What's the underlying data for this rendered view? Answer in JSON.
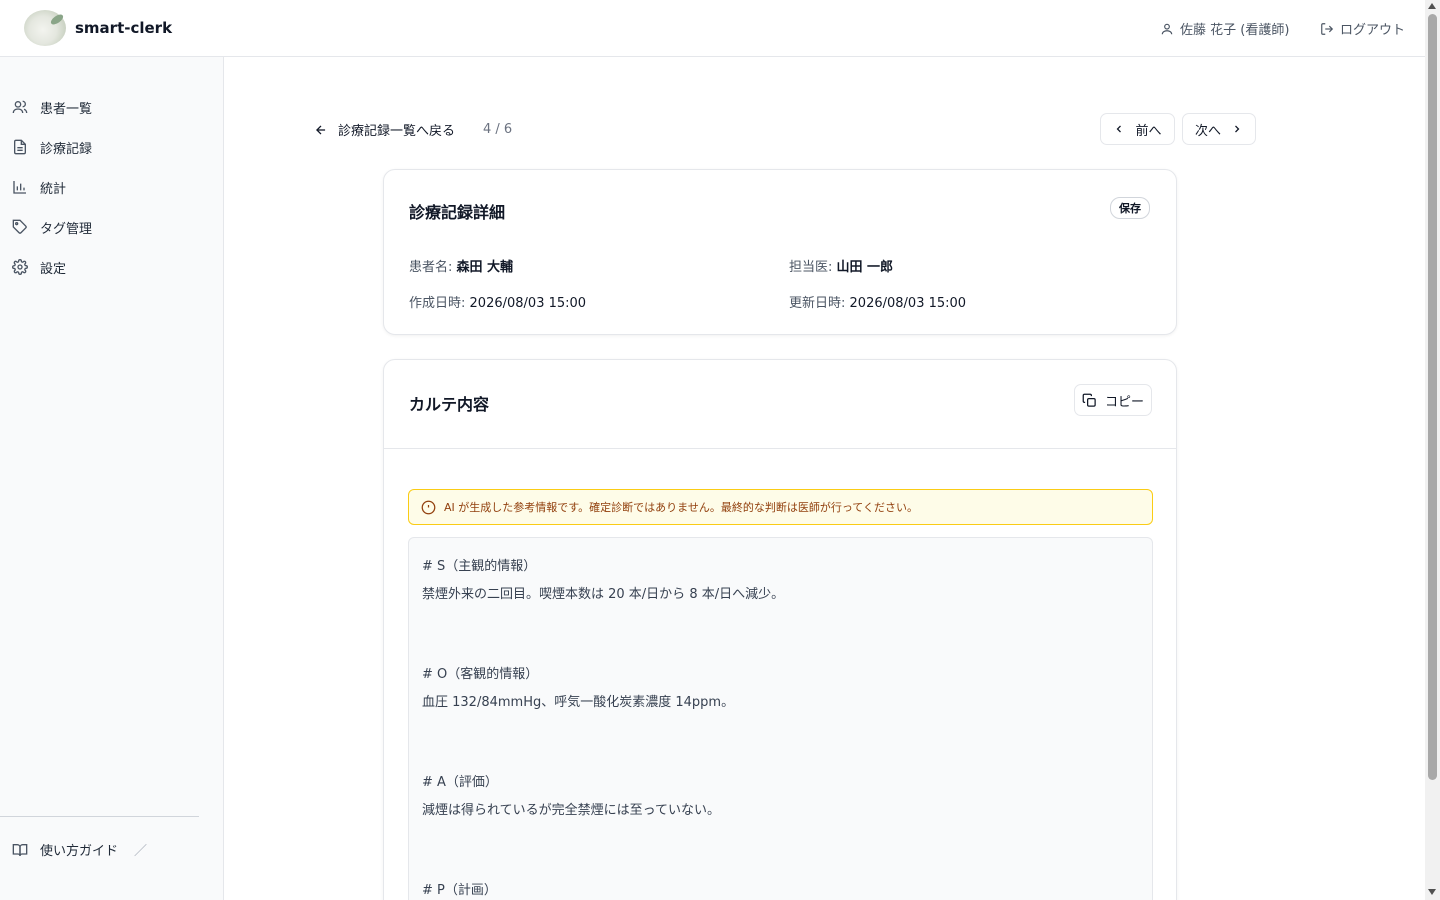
{
  "header": {
    "brand": "smart-clerk",
    "user": "佐藤 花子 (看護師)",
    "logout": "ログアウト"
  },
  "sidebar": {
    "items": [
      {
        "label": "患者一覧",
        "icon": "users-icon"
      },
      {
        "label": "診療記録",
        "icon": "file-text-icon"
      },
      {
        "label": "統計",
        "icon": "bar-chart-icon"
      },
      {
        "label": "タグ管理",
        "icon": "tag-icon"
      },
      {
        "label": "設定",
        "icon": "gear-icon"
      }
    ],
    "guide": "使い方ガイド",
    "guide_suffix": "／"
  },
  "nav": {
    "back_label": "診療記録一覧へ戻る",
    "counter": "4 / 6",
    "prev_label": "前へ",
    "next_label": "次へ"
  },
  "record": {
    "title": "診療記録詳細",
    "status_badge": "保存",
    "patient_label": "患者名:",
    "patient_name": "森田 大輔",
    "doctor_label": "担当医:",
    "doctor_name": "山田 一郎",
    "created_label": "作成日時:",
    "created_value": "2026/08/03 15:00",
    "updated_label": "更新日時:",
    "updated_value": "2026/08/03 15:00"
  },
  "chart": {
    "title": "カルテ内容",
    "copy_label": "コピー",
    "warning": "AI が生成した参考情報です。確定診断ではありません。最終的な判断は医師が行ってください。",
    "lines": [
      "# S（主観的情報）",
      "禁煙外来の二回目。喫煙本数は 20 本/日から 8 本/日へ減少。",
      "# O（客観的情報）",
      "血圧 132/84mmHg、呼気一酸化炭素濃度 14ppm。",
      "# A（評価）",
      "減煙は得られているが完全禁煙には至っていない。",
      "# P（計画）"
    ]
  }
}
